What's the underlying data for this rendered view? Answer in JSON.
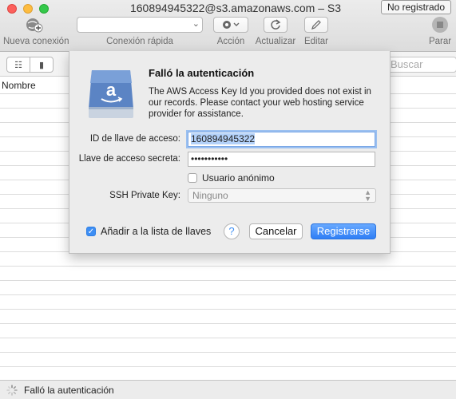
{
  "window": {
    "title": "160894945322@s3.amazonaws.com – S3",
    "registration_badge": "No registrado"
  },
  "toolbar": {
    "new_connection": "Nueva conexión",
    "quick_connect": "Conexión rápida",
    "action": "Acción",
    "refresh": "Actualizar",
    "edit": "Editar",
    "stop": "Parar"
  },
  "browser": {
    "search_placeholder": "Buscar",
    "column_name": "Nombre"
  },
  "dialog": {
    "title": "Falló la autenticación",
    "message": "The AWS Access Key Id you provided does not exist in our records. Please contact your web hosting service provider for assistance.",
    "access_key_label": "ID de llave de acceso:",
    "access_key_value": "160894945322",
    "secret_key_label": "Llave de acceso secreta:",
    "secret_key_value": "•••••••••••",
    "anonymous_label": "Usuario anónimo",
    "anonymous_checked": false,
    "ssh_key_label": "SSH Private Key:",
    "ssh_key_value": "Ninguno",
    "keychain_label": "Añadir a la lista de llaves",
    "keychain_checked": true,
    "help_label": "?",
    "cancel_label": "Cancelar",
    "login_label": "Registrarse"
  },
  "status": {
    "text": "Falló la autenticación"
  },
  "colors": {
    "accent": "#3d8ef4",
    "amazon_disk": "#5b84c4"
  }
}
